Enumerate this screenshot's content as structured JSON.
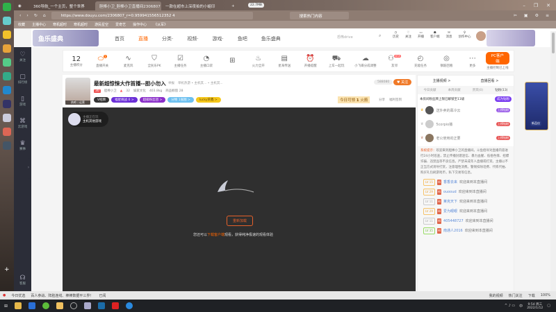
{
  "browser": {
    "tabs": [
      {
        "label": "360导航_一个主页，整个世界"
      },
      {
        "label": "胆棒小卫_胆棒小卫直播间2306807"
      },
      {
        "label": "一款在超市上深夜拍的小蛆印"
      }
    ],
    "url": "https://www.douyu.com/2306807_r=0.959941556512352 4",
    "net_speed": "22.7MB",
    "search_placeholder": "搜索热门内容",
    "bookmarks": [
      "收藏",
      "主播中心",
      "寒机超时",
      "寒机超时",
      "游民星空",
      "爱奇艺",
      "操作中心",
      "《从军》"
    ]
  },
  "desktop_apps": [
    "360安全浏览器"
  ],
  "douyu_sidebar": [
    {
      "label": "关注"
    },
    {
      "label": "排行榜"
    },
    {
      "label": "游戏"
    },
    {
      "label": "云游戏"
    },
    {
      "label": "赛事"
    },
    {
      "label": "客服"
    }
  ],
  "header": {
    "nav": [
      "首页",
      "直播",
      "分类·",
      "视频·",
      "游戏·",
      "鱼吧",
      "鱼乐盛典"
    ],
    "logo": "鱼乐盛典",
    "search_placeholder": "恐怖drive",
    "actions": [
      "历史",
      "关注",
      "开播",
      "客户端",
      "消息",
      "创作中心"
    ]
  },
  "toolbar": {
    "score": "12",
    "score_label": "主播积分",
    "items": [
      "直播开关",
      "麦克风",
      "全民乐PK",
      "主播任务",
      "主播口袋",
      "火力全开",
      "星海传送",
      "开播提醒",
      "上车一起玩",
      "小飞碟分成调整",
      "友邻",
      "充能任务",
      "钢筋回看",
      "更多"
    ],
    "badge_new": "NEW",
    "badge_count": "1",
    "pc_button": "PC客户端",
    "pc_sub": "主播控制已上线"
  },
  "room": {
    "title": "最新超惊悚大作首播--胆小勿入",
    "report": "举报",
    "category": "单机热游 • 主机其... • 主机其...",
    "level": "30",
    "anchor": "胆棒小卫",
    "heat": "32",
    "guild": "娱家文化",
    "weight": "403.8kg",
    "gifts": "商品橱窗 28",
    "avatar_caption": "热吧 | 运营",
    "tags": [
      "V招牌",
      "福星挑战 0 >",
      "超级粉丝团 >",
      "分物 1张图 >",
      "lucky荣鑫 >"
    ],
    "count": "588080",
    "follow": "关注",
    "today": "今日可领",
    "fire": "1",
    "fire_label": "火箭",
    "share": "分享",
    "benefit": "福利签到"
  },
  "video": {
    "badge_title": "主播正在玩",
    "badge_game": "主机其他游戏",
    "reload": "重新加载",
    "hint_pre": "您还可以",
    "hint_link": "下载客户端",
    "hint_post": "观看，获得纯净极速的观看体验"
  },
  "right": {
    "links": [
      "主播视频 >",
      "直播回看 >"
    ],
    "tabs": [
      "今日贡献",
      "本周贡献",
      "贵宾(0)",
      "钻粉(13)"
    ],
    "fan_notice": "本房间粉丝牌上限已解锁至11级",
    "fan_btn": "成为钻粉",
    "ranks": [
      {
        "name": "送外卖的幕冷云",
        "badge": "上榜钻粉"
      },
      {
        "name": "5corpio播",
        "badge": "上榜钻粉"
      },
      {
        "name": "老公使用劲正要",
        "badge": "上榜钻粉"
      }
    ],
    "system_label": "系统提示：",
    "system_msg": "欢迎来到胆棒小卫的直播间。斗鱼倡导对直播内容进行24小时巡查，禁止传播封建迷信、暴力血腥、低俗色情、招嫖诈骗、违禁品等不良信息。严禁未成年人直播或打赏。主播以不正当方式诱导打赏，注意理性消费。警惕扣除话费、代练代抽、购买礼包刷游戏币，私下交易等信息。",
    "chats": [
      {
        "lv": "LV 15",
        "name": "香香去来",
        "msg": "欢迎来到本直播间"
      },
      {
        "lv": "LV 29",
        "name": "ouooud",
        "msg": "欢迎来到本直播间"
      },
      {
        "lv": "LV 11",
        "name": "莱克天下",
        "msg": "欢迎来到本直播间"
      },
      {
        "lv": "LV 29",
        "name": "爱为眼眼",
        "msg": "欢迎来到本直播间"
      },
      {
        "lv": "LV 11",
        "name": "405448727",
        "msg": "欢迎来到本直播间"
      },
      {
        "lv": "LV 35",
        "name": "南通人2016",
        "msg": "欢迎来到本直播间"
      }
    ],
    "ad_label": "新品仪"
  },
  "statusbar": {
    "left": "今日优选",
    "news": "百人参战、阵脸连线、棒棒数据平三界！",
    "tag": "已阅",
    "right": [
      "我的视频",
      "热门关注",
      "下载",
      "100%"
    ]
  },
  "taskbar": {
    "time": "9:54 周三",
    "date": "2022/1/12",
    "ime": "中"
  },
  "colors": {
    "accent": "#ff6600",
    "sidebar": "#2b2d38",
    "video": "#2f2f2f"
  }
}
